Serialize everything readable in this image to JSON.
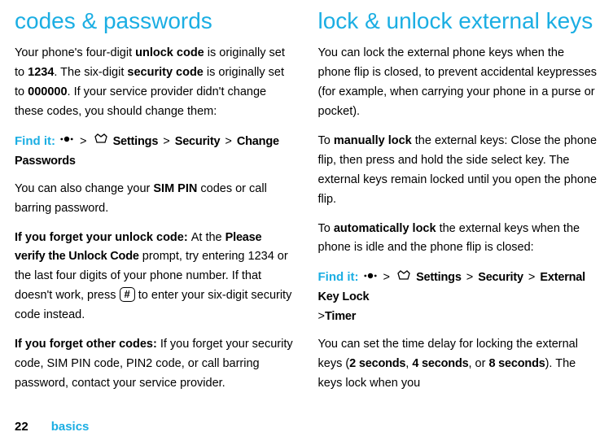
{
  "left": {
    "heading": "codes & passwords",
    "p1_a": "Your phone's four-digit ",
    "p1_b": "unlock code",
    "p1_c": " is originally set to ",
    "p1_d": "1234",
    "p1_e": ". The six-digit ",
    "p1_f": "security code",
    "p1_g": " is originally set to ",
    "p1_h": "000000",
    "p1_i": ". If your service provider didn't change these codes, you should change them:",
    "findit_label": "Find it:",
    "path1": {
      "a": "Settings",
      "b": "Security",
      "c": "Change Passwords"
    },
    "p2_a": "You can also change your ",
    "p2_b": "SIM PIN",
    "p2_c": " codes or call barring password.",
    "p3_a": "If you forget your unlock code: ",
    "p3_b": "At the ",
    "p3_c": "Please verify the Unlock Code",
    "p3_d": " prompt, try entering 1234 or the last four digits of your phone number. If that doesn't work, press ",
    "p3_key": "#",
    "p3_e": " to enter your six-digit security code instead.",
    "p4_a": "If you forget other codes: ",
    "p4_b": "If you forget your security code, SIM PIN code, PIN2 code, or call barring password, contact your service provider."
  },
  "right": {
    "heading": "lock & unlock external keys",
    "p1": "You can lock the external phone keys when the phone flip is closed, to prevent accidental keypresses (for example, when carrying your phone in a purse or pocket).",
    "p2_a": "To ",
    "p2_b": "manually lock",
    "p2_c": " the external keys: Close the phone flip, then press and hold the side select key. The external keys remain locked until you open the phone flip.",
    "p3_a": "To ",
    "p3_b": "automatically lock",
    "p3_c": " the external keys when the phone is idle and the phone flip is closed:",
    "findit_label": "Find it:",
    "path2": {
      "a": "Settings",
      "b": "Security",
      "c": "External Key Lock",
      "d": "Timer"
    },
    "p4_a": "You can set the time delay for locking the external keys (",
    "p4_b": "2 seconds",
    "p4_c": ", ",
    "p4_d": "4 seconds",
    "p4_e": ", or ",
    "p4_f": "8 seconds",
    "p4_g": "). The keys lock when you"
  },
  "footer": {
    "page": "22",
    "section": "basics"
  }
}
